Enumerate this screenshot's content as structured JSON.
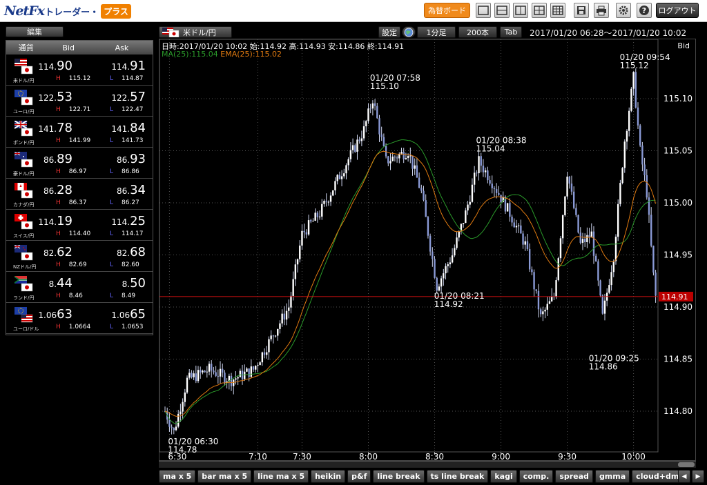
{
  "app": {
    "logo_main": "NetFx",
    "logo_sub": "トレーダー・",
    "logo_badge": "プラス",
    "rate_board_label": "為替ボード",
    "logout_label": "ログアウト",
    "toolbar_icons": [
      "layout-single-icon",
      "layout-horizontal-icon",
      "layout-vertical-icon",
      "layout-grid-icon",
      "save-icon",
      "print-icon",
      "gear-icon",
      "help-icon"
    ]
  },
  "left": {
    "edit_label": "編集",
    "headers": {
      "pair": "通貨",
      "bid": "Bid",
      "ask": "Ask"
    },
    "rows": [
      {
        "name": "米ドル/円",
        "bid_a": "114.",
        "bid_b": "90",
        "ask_a": "114.",
        "ask_b": "91",
        "h_label": "H",
        "high": "115.12",
        "l_label": "L",
        "low": "114.87",
        "flag": "us-jp"
      },
      {
        "name": "ユーロ/円",
        "bid_a": "122.",
        "bid_b": "53",
        "ask_a": "122.",
        "ask_b": "57",
        "h_label": "H",
        "high": "122.71",
        "l_label": "L",
        "low": "122.47",
        "flag": "eu-jp"
      },
      {
        "name": "ポンド/円",
        "bid_a": "141.",
        "bid_b": "78",
        "ask_a": "141.",
        "ask_b": "84",
        "h_label": "H",
        "high": "141.99",
        "l_label": "L",
        "low": "141.73",
        "flag": "gb-jp"
      },
      {
        "name": "豪ドル/円",
        "bid_a": "86.",
        "bid_b": "89",
        "ask_a": "86.",
        "ask_b": "93",
        "h_label": "H",
        "high": "86.97",
        "l_label": "L",
        "low": "86.86",
        "flag": "au-jp"
      },
      {
        "name": "カナダ/円",
        "bid_a": "86.",
        "bid_b": "28",
        "ask_a": "86.",
        "ask_b": "34",
        "h_label": "H",
        "high": "86.37",
        "l_label": "L",
        "low": "86.27",
        "flag": "ca-jp"
      },
      {
        "name": "スイス/円",
        "bid_a": "114.",
        "bid_b": "19",
        "ask_a": "114.",
        "ask_b": "25",
        "h_label": "H",
        "high": "114.40",
        "l_label": "L",
        "low": "114.17",
        "flag": "ch-jp"
      },
      {
        "name": "NZドル/円",
        "bid_a": "82.",
        "bid_b": "62",
        "ask_a": "82.",
        "ask_b": "68",
        "h_label": "H",
        "high": "82.69",
        "l_label": "L",
        "low": "82.60",
        "flag": "nz-jp"
      },
      {
        "name": "ランド/円",
        "bid_a": "8.",
        "bid_b": "44",
        "ask_a": "8.",
        "ask_b": "50",
        "h_label": "H",
        "high": "8.46",
        "l_label": "L",
        "low": "8.49",
        "flag": "za-jp"
      },
      {
        "name": "ユーロ/ドル",
        "bid_a": "1.06",
        "bid_b": "63",
        "ask_a": "1.06",
        "ask_b": "65",
        "h_label": "H",
        "high": "1.0664",
        "l_label": "L",
        "low": "1.0653",
        "flag": "eu-us"
      }
    ]
  },
  "chart": {
    "pair_label": "米ドル/円",
    "settings_label": "設定",
    "interval_label": "1分足",
    "count_label": "200本",
    "tab_label": "Tab",
    "range": "2017/01/20 06:28～2017/01/20 10:02",
    "info": "日時:2017/01/20 10:02 始:114.92 高:114.93 安:114.86 終:114.91",
    "ma_label": "MA(25):115.04",
    "ema_label": "EMA(25):115.02",
    "side_label": "Bid",
    "current_price": "114.91",
    "annotations": [
      {
        "time": "01/20 06:30",
        "price": "114.78"
      },
      {
        "time": "01/20 07:58",
        "price": "115.10"
      },
      {
        "time": "01/20 08:21",
        "price": "114.92"
      },
      {
        "time": "01/20 08:38",
        "price": "115.04"
      },
      {
        "time": "01/20 09:25",
        "price": "114.86"
      },
      {
        "time": "01/20 09:54",
        "price": "115.12"
      }
    ],
    "y_ticks": [
      "115.10",
      "115.05",
      "115.00",
      "114.95",
      "114.90",
      "114.85",
      "114.80"
    ],
    "x_ticks": [
      "6:30",
      "7:10",
      "7:30",
      "8:00",
      "8:30",
      "9:00",
      "9:30",
      "10:00"
    ],
    "colors": {
      "ma": "#2a9a2a",
      "ema": "#e07a10",
      "candle": "#8a9ad6",
      "price_line": "#d01010",
      "grid": "#555555"
    },
    "tabs": [
      "ma x 5",
      "bar ma x 5",
      "line ma x 5",
      "heikin",
      "p&f",
      "line break",
      "ts line break",
      "kagi",
      "comp.",
      "spread",
      "gmma",
      "cloud+dmi"
    ],
    "nav_left": "◀",
    "nav_right": "▶"
  }
}
